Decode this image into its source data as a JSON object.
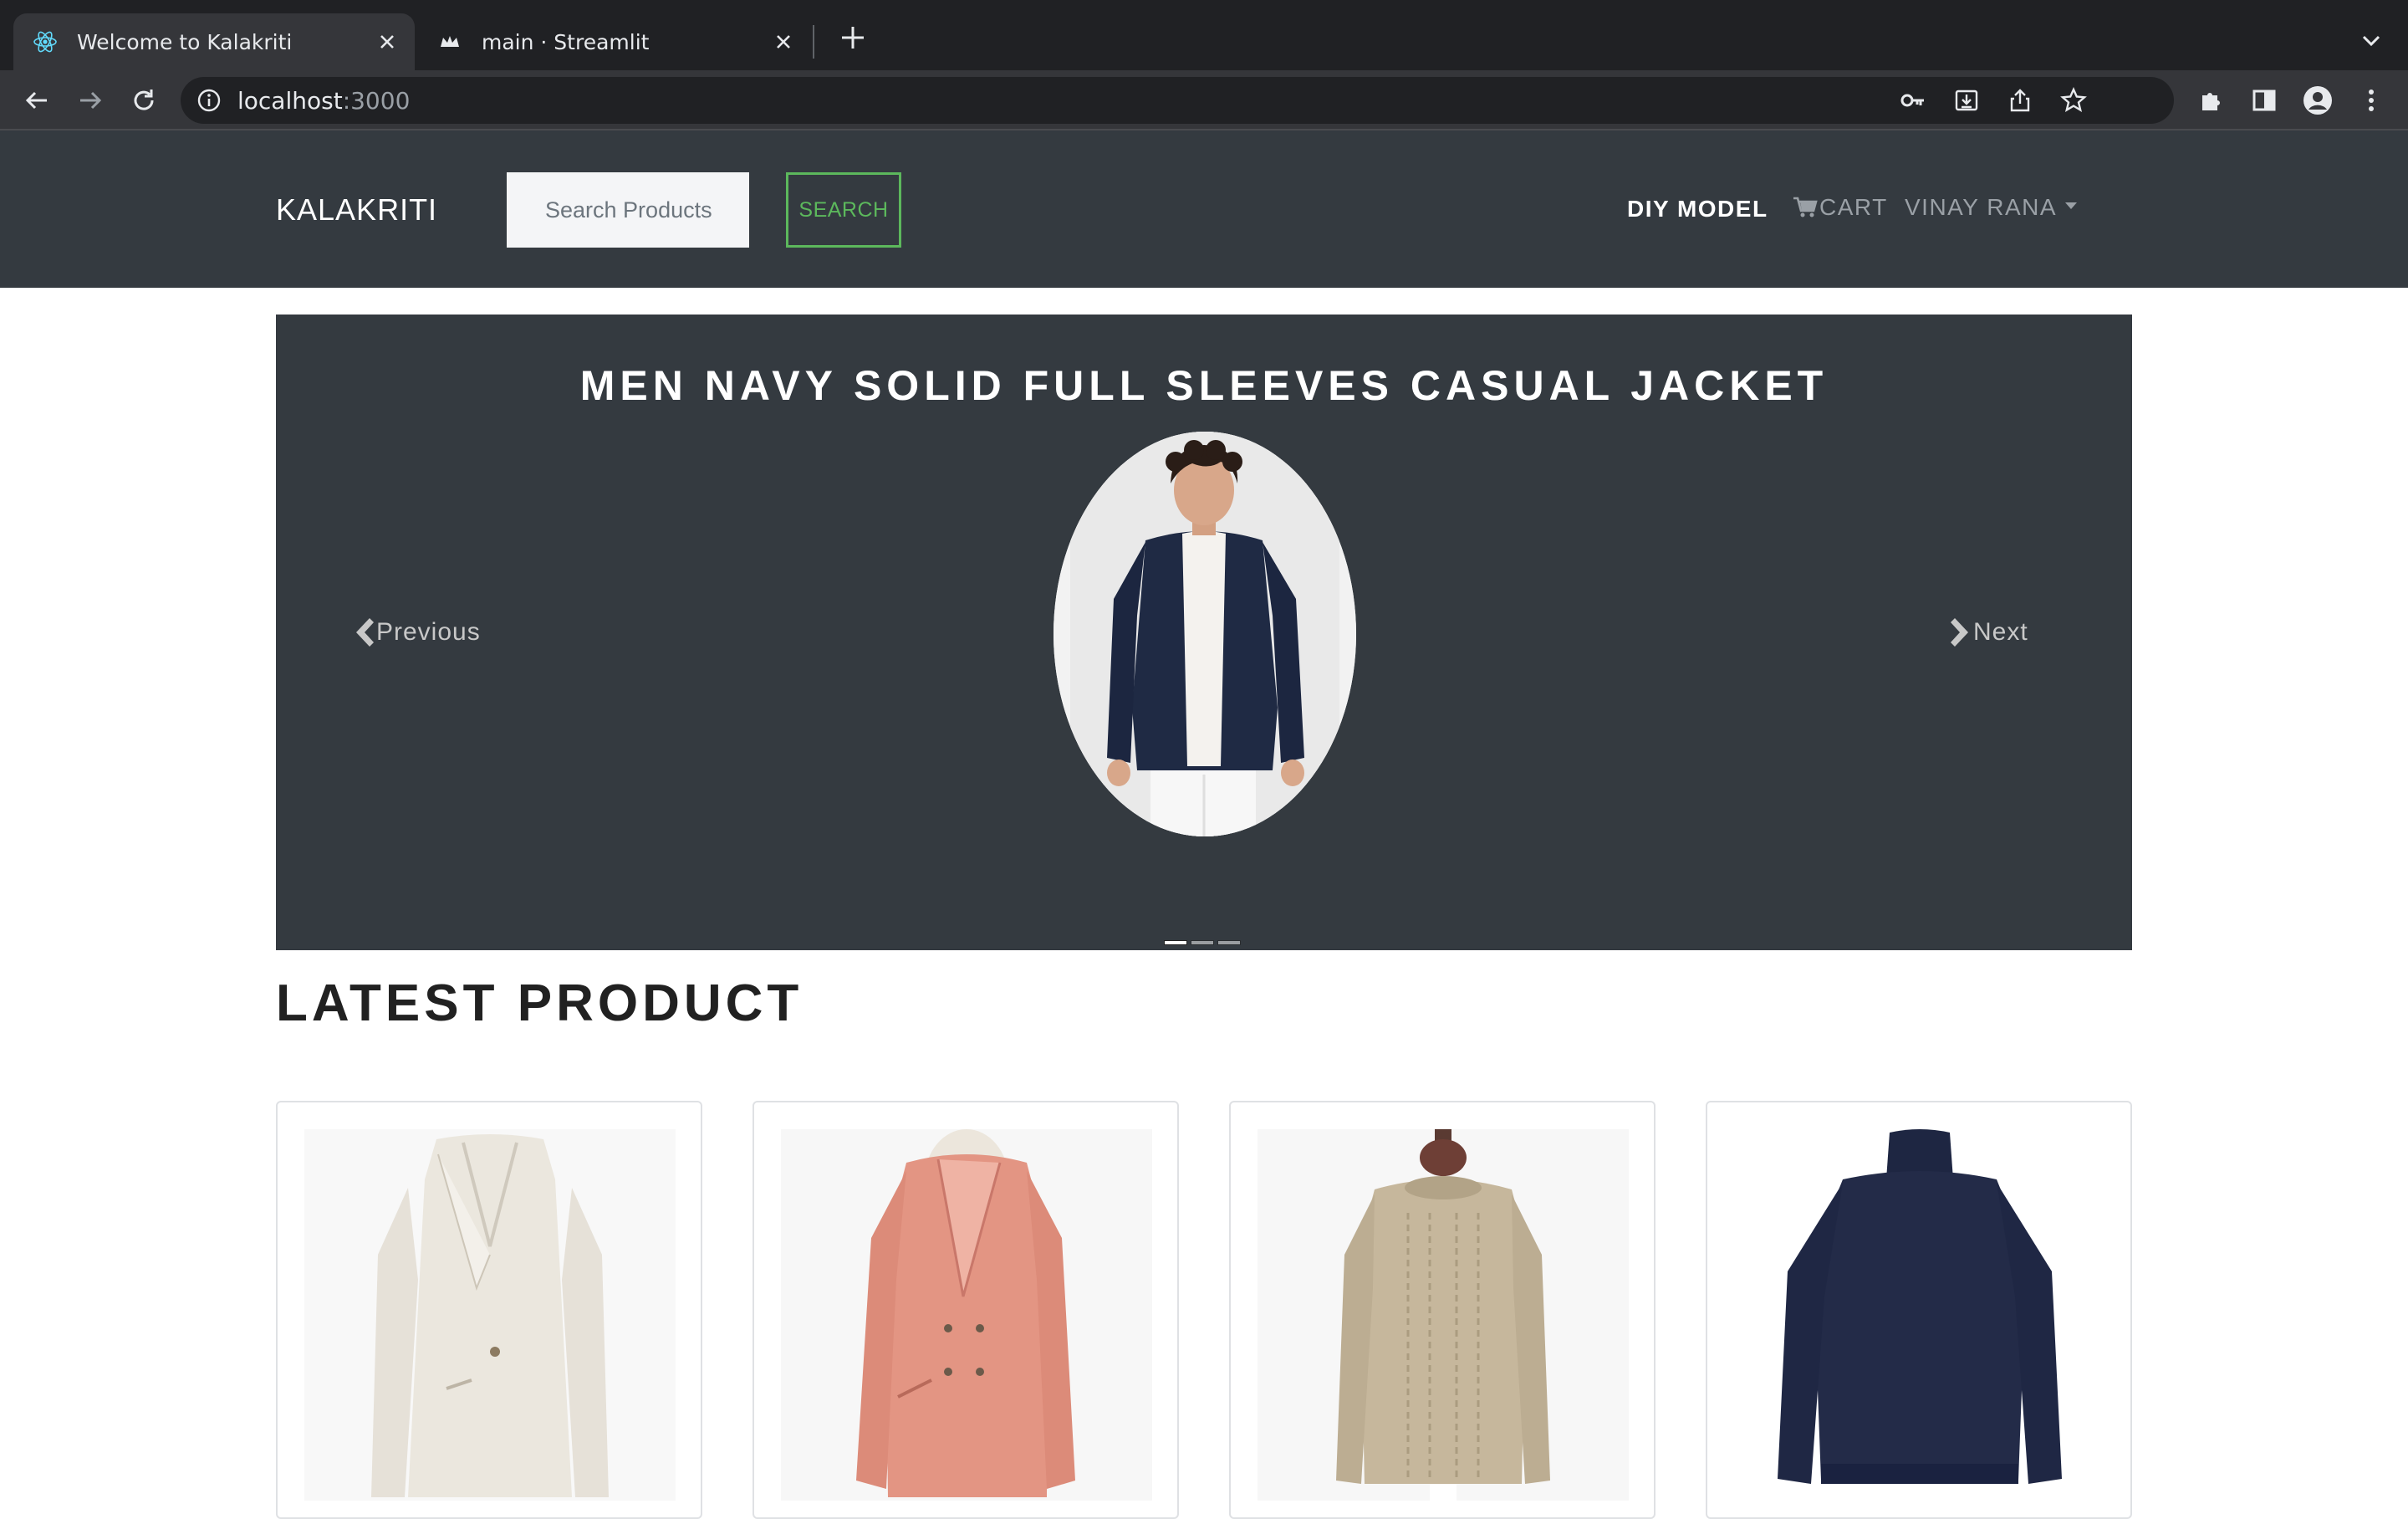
{
  "browser": {
    "tabs": [
      {
        "title": "Welcome to Kalakriti",
        "active": true,
        "icon": "react-icon"
      },
      {
        "title": "main · Streamlit",
        "active": false,
        "icon": "streamlit-crown-icon"
      }
    ],
    "url_host": "localhost",
    "url_port": ":3000"
  },
  "navbar": {
    "brand": "KALAKRITI",
    "search_placeholder": "Search Products",
    "search_button": "SEARCH",
    "diy_model": "DIY MODEL",
    "cart": "CART",
    "user": "VINAY RANA"
  },
  "carousel": {
    "title": "MEN NAVY SOLID FULL SLEEVES CASUAL JACKET",
    "prev_label": "Previous",
    "next_label": "Next",
    "slide_count": 3,
    "active_slide": 1
  },
  "latest": {
    "title": "LATEST PRODUCT",
    "products": [
      {
        "image": "white-blazer"
      },
      {
        "image": "peach-coat"
      },
      {
        "image": "beige-cable-knit-sweater"
      },
      {
        "image": "navy-turtleneck-sweater"
      }
    ]
  },
  "colors": {
    "navbar_bg": "#343a40",
    "search_accent": "#5cb85c",
    "browser_bg": "#202124"
  }
}
